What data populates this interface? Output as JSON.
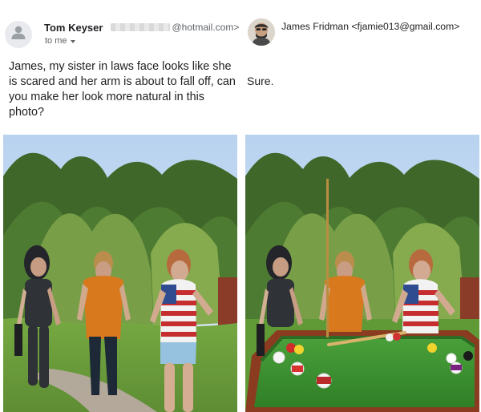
{
  "left_email": {
    "sender_name": "Tom Keyser",
    "sender_domain": "@hotmail.com>",
    "to_label": "to me",
    "message": "James, my sister in laws face looks like she is scared and her arm is about to fall off, can you make her look more natural in this photo?"
  },
  "right_email": {
    "sender": "James Fridman <fjamie013@gmail.com>",
    "message": "Sure."
  },
  "icons": {
    "default_avatar": "person-icon",
    "expand": "chevron-down-icon"
  },
  "colors": {
    "text": "#202124",
    "muted": "#5f6368",
    "avatar_bg": "#e8eaed",
    "table_felt": "#3f8f2c",
    "table_rail": "#8a3b20"
  }
}
